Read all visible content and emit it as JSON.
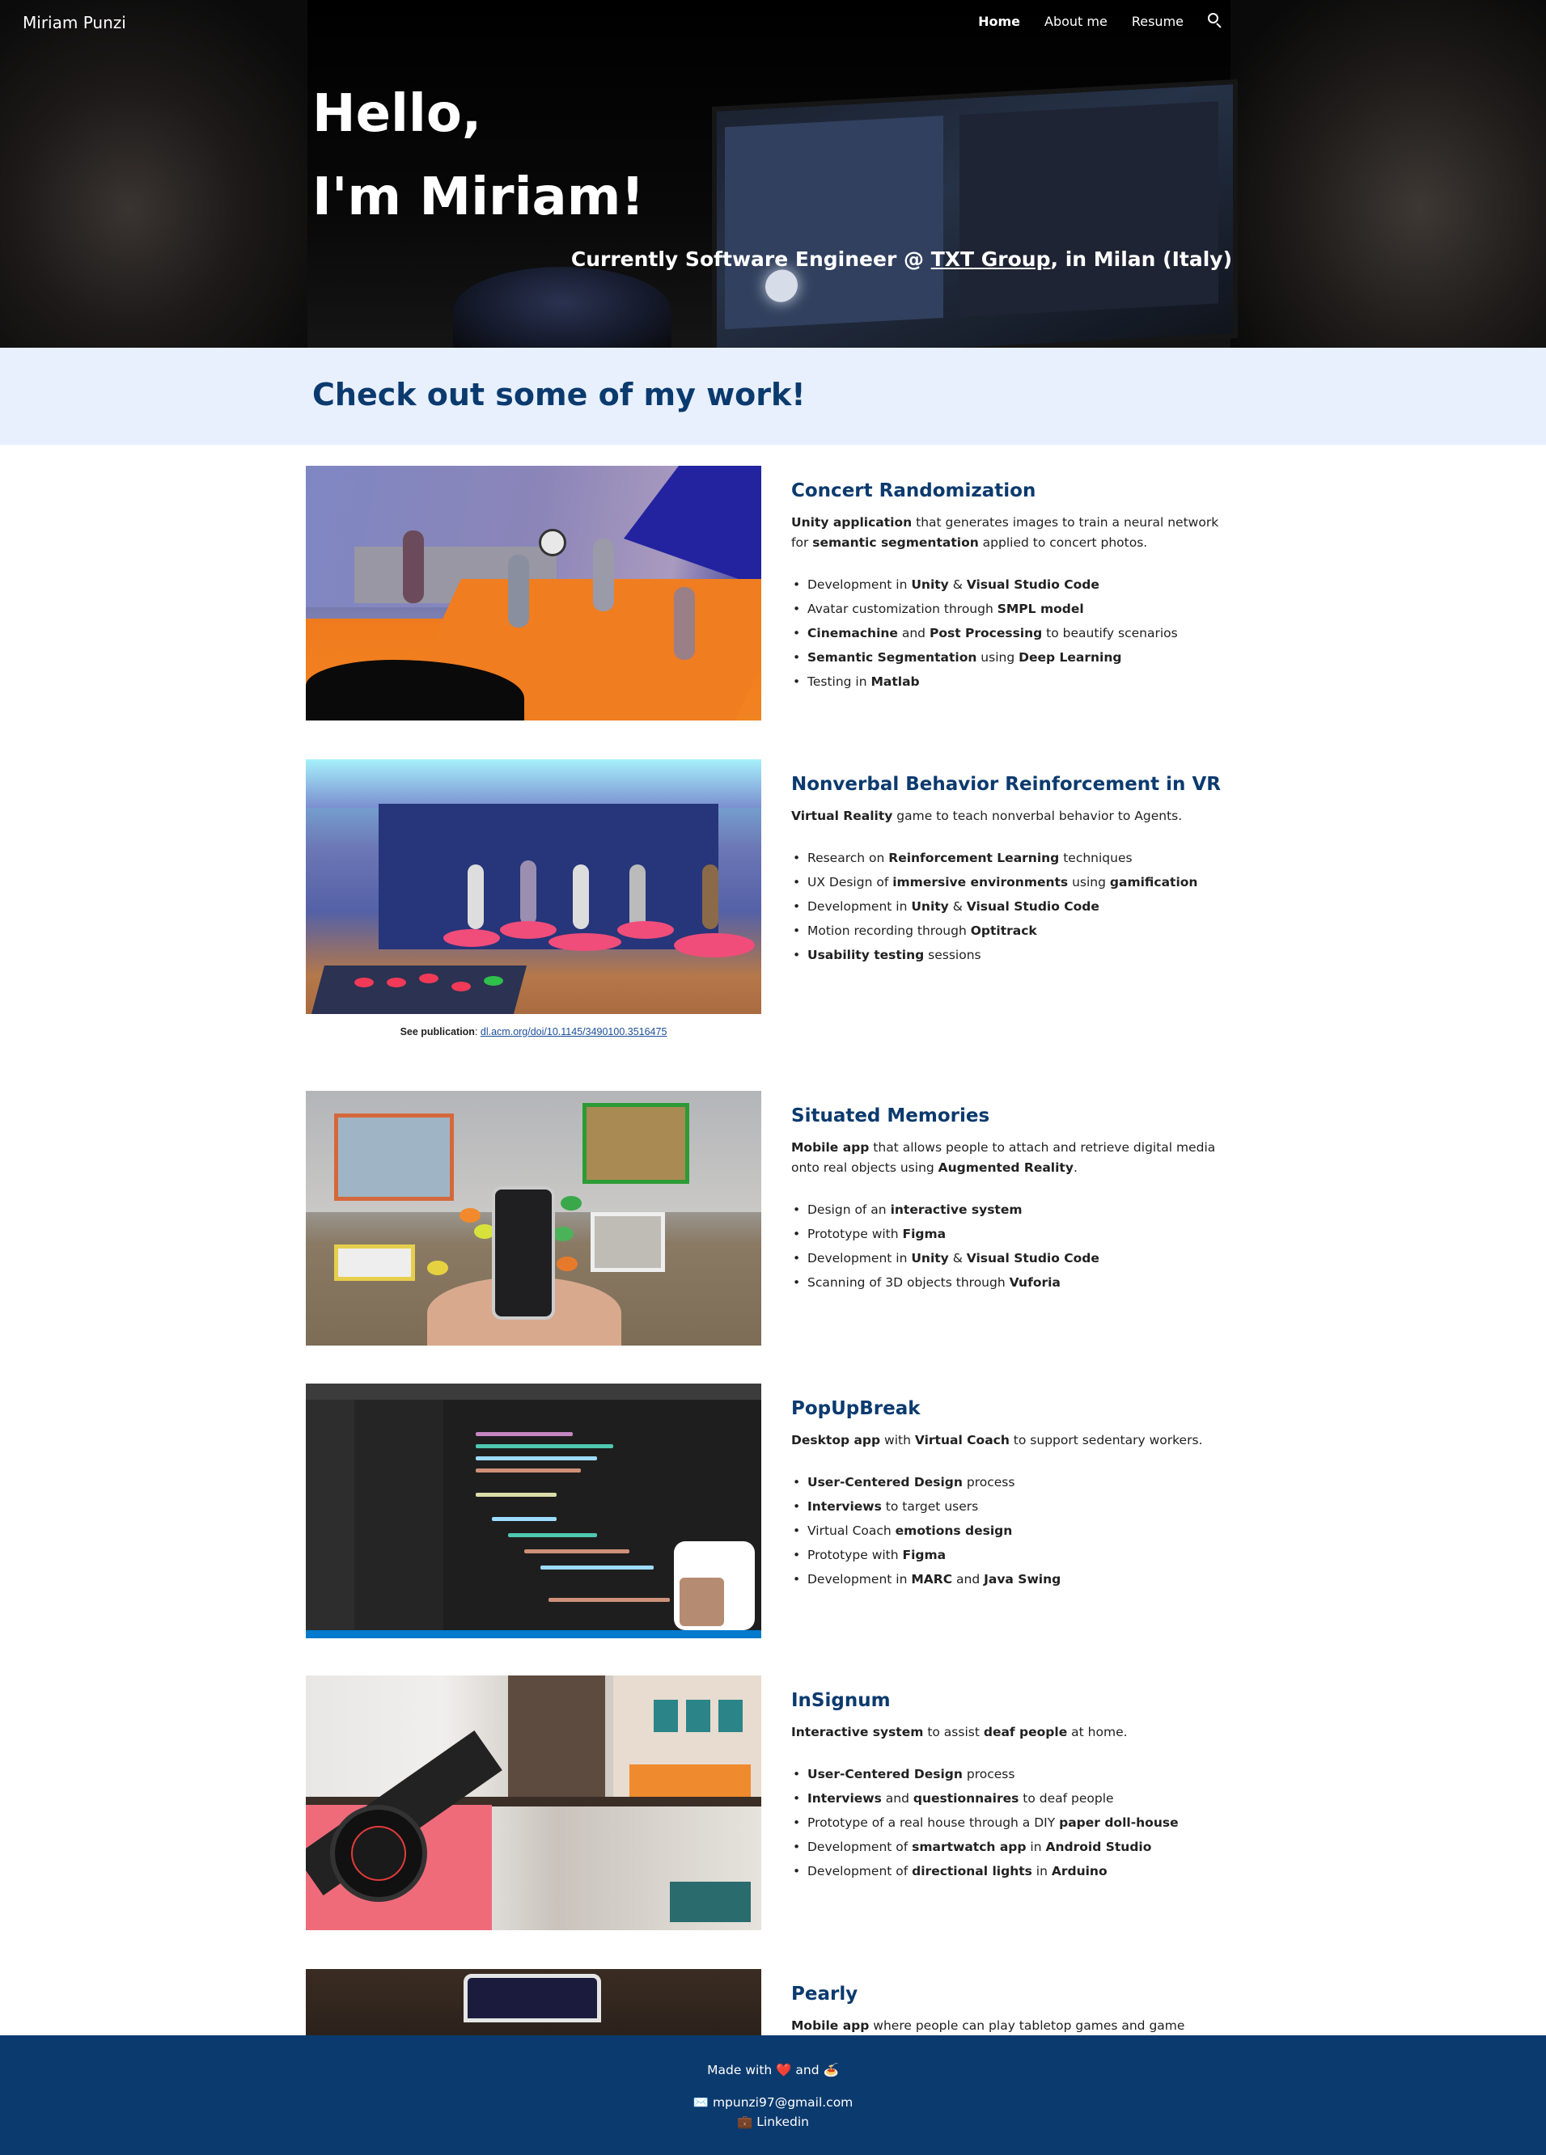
{
  "header": {
    "brand": "Miriam Punzi",
    "nav": [
      {
        "label": "Home",
        "active": true
      },
      {
        "label": "About me",
        "active": false
      },
      {
        "label": "Resume",
        "active": false
      }
    ],
    "search_icon": "search-icon"
  },
  "hero": {
    "line1": "Hello,",
    "line2": "I'm Miriam!",
    "subtitle_pre": "Currently Software Engineer @ ",
    "subtitle_link": "TXT Group",
    "subtitle_post": ", in Milan (Italy)"
  },
  "work": {
    "title": "Check out some of my work!"
  },
  "projects": [
    {
      "title": "Concert Randomization",
      "desc": [
        {
          "b": "Unity application"
        },
        {
          "t": " that generates images to train a neural network for "
        },
        {
          "b": "semantic segmentation"
        },
        {
          "t": " applied to concert photos."
        }
      ],
      "items": [
        [
          {
            "t": "Development in "
          },
          {
            "b": "Unity"
          },
          {
            "t": " & "
          },
          {
            "b": "Visual Studio Code"
          }
        ],
        [
          {
            "t": "Avatar customization through "
          },
          {
            "b": "SMPL model"
          }
        ],
        [
          {
            "b": "Cinemachine"
          },
          {
            "t": " and "
          },
          {
            "b": "Post Processing"
          },
          {
            "t": " to beautify scenarios"
          }
        ],
        [
          {
            "b": "Semantic Segmentation"
          },
          {
            "t": " using "
          },
          {
            "b": "Deep Learning"
          }
        ],
        [
          {
            "t": "Testing in "
          },
          {
            "b": "Matlab"
          }
        ]
      ]
    },
    {
      "title": "Nonverbal Behavior Reinforcement in VR",
      "desc": [
        {
          "b": "Virtual Reality"
        },
        {
          "t": " game to teach nonverbal behavior to Agents."
        }
      ],
      "items": [
        [
          {
            "t": "Research on "
          },
          {
            "b": "Reinforcement Learning"
          },
          {
            "t": " techniques"
          }
        ],
        [
          {
            "t": "UX Design of "
          },
          {
            "b": "immersive environments"
          },
          {
            "t": " using "
          },
          {
            "b": "gamification"
          }
        ],
        [
          {
            "t": "Development in "
          },
          {
            "b": "Unity"
          },
          {
            "t": " & "
          },
          {
            "b": "Visual Studio Code"
          }
        ],
        [
          {
            "t": "Motion recording through "
          },
          {
            "b": "Optitrack"
          }
        ],
        [
          {
            "b": "Usability testing"
          },
          {
            "t": " sessions"
          }
        ]
      ],
      "publication": {
        "label": "See publication",
        "link": "dl.acm.org/doi/10.1145/3490100.3516475"
      }
    },
    {
      "title": "Situated Memories",
      "desc": [
        {
          "b": "Mobile app"
        },
        {
          "t": " that allows people to attach and retrieve digital media onto real objects using "
        },
        {
          "b": "Augmented Reality"
        },
        {
          "t": "."
        }
      ],
      "items": [
        [
          {
            "t": "Design of an "
          },
          {
            "b": "interactive system"
          }
        ],
        [
          {
            "t": "Prototype with "
          },
          {
            "b": "Figma"
          }
        ],
        [
          {
            "t": "Development in "
          },
          {
            "b": "Unity"
          },
          {
            "t": " & "
          },
          {
            "b": "Visual Studio Code"
          }
        ],
        [
          {
            "t": "Scanning of 3D objects through "
          },
          {
            "b": "Vuforia"
          }
        ]
      ]
    },
    {
      "title": "PopUpBreak",
      "desc": [
        {
          "b": "Desktop app"
        },
        {
          "t": " with "
        },
        {
          "b": "Virtual Coach"
        },
        {
          "t": " to support sedentary workers."
        }
      ],
      "items": [
        [
          {
            "b": "User-Centered Design"
          },
          {
            "t": " process"
          }
        ],
        [
          {
            "b": "Interviews"
          },
          {
            "t": " to target users"
          }
        ],
        [
          {
            "t": "Virtual Coach "
          },
          {
            "b": "emotions design"
          }
        ],
        [
          {
            "t": "Prototype with "
          },
          {
            "b": "Figma"
          }
        ],
        [
          {
            "t": "Development in "
          },
          {
            "b": "MARC"
          },
          {
            "t": " and "
          },
          {
            "b": "Java Swing"
          }
        ]
      ]
    },
    {
      "title": "InSignum",
      "desc": [
        {
          "b": "Interactive system"
        },
        {
          "t": " to assist "
        },
        {
          "b": "deaf people"
        },
        {
          "t": " at home."
        }
      ],
      "items": [
        [
          {
            "b": "User-Centered Design"
          },
          {
            "t": " process"
          }
        ],
        [
          {
            "b": "Interviews"
          },
          {
            "t": " and "
          },
          {
            "b": "questionnaires"
          },
          {
            "t": " to deaf people"
          }
        ],
        [
          {
            "t": "Prototype of a real house through a DIY "
          },
          {
            "b": "paper doll-house"
          }
        ],
        [
          {
            "t": "Development of "
          },
          {
            "b": "smartwatch app"
          },
          {
            "t": " in "
          },
          {
            "b": "Android Studio"
          }
        ],
        [
          {
            "t": "Development of "
          },
          {
            "b": "directional lights"
          },
          {
            "t": " in "
          },
          {
            "b": "Arduino"
          }
        ]
      ]
    },
    {
      "title": "Pearly",
      "desc": [
        {
          "b": "Mobile app"
        },
        {
          "t": " where people can play tabletop games and game creators"
        }
      ],
      "items": []
    }
  ],
  "footer": {
    "made_pre": "Made with ",
    "made_heart": "❤️",
    "made_mid": " and ",
    "made_food": "🍝",
    "email_icon": "✉️",
    "email": "mpunzi97@gmail.com",
    "linkedin_icon": "💼",
    "linkedin": "Linkedin"
  },
  "colors": {
    "primary": "#0b3a6e",
    "banner_bg": "#e8f0fe",
    "link": "#1a4f9c"
  }
}
